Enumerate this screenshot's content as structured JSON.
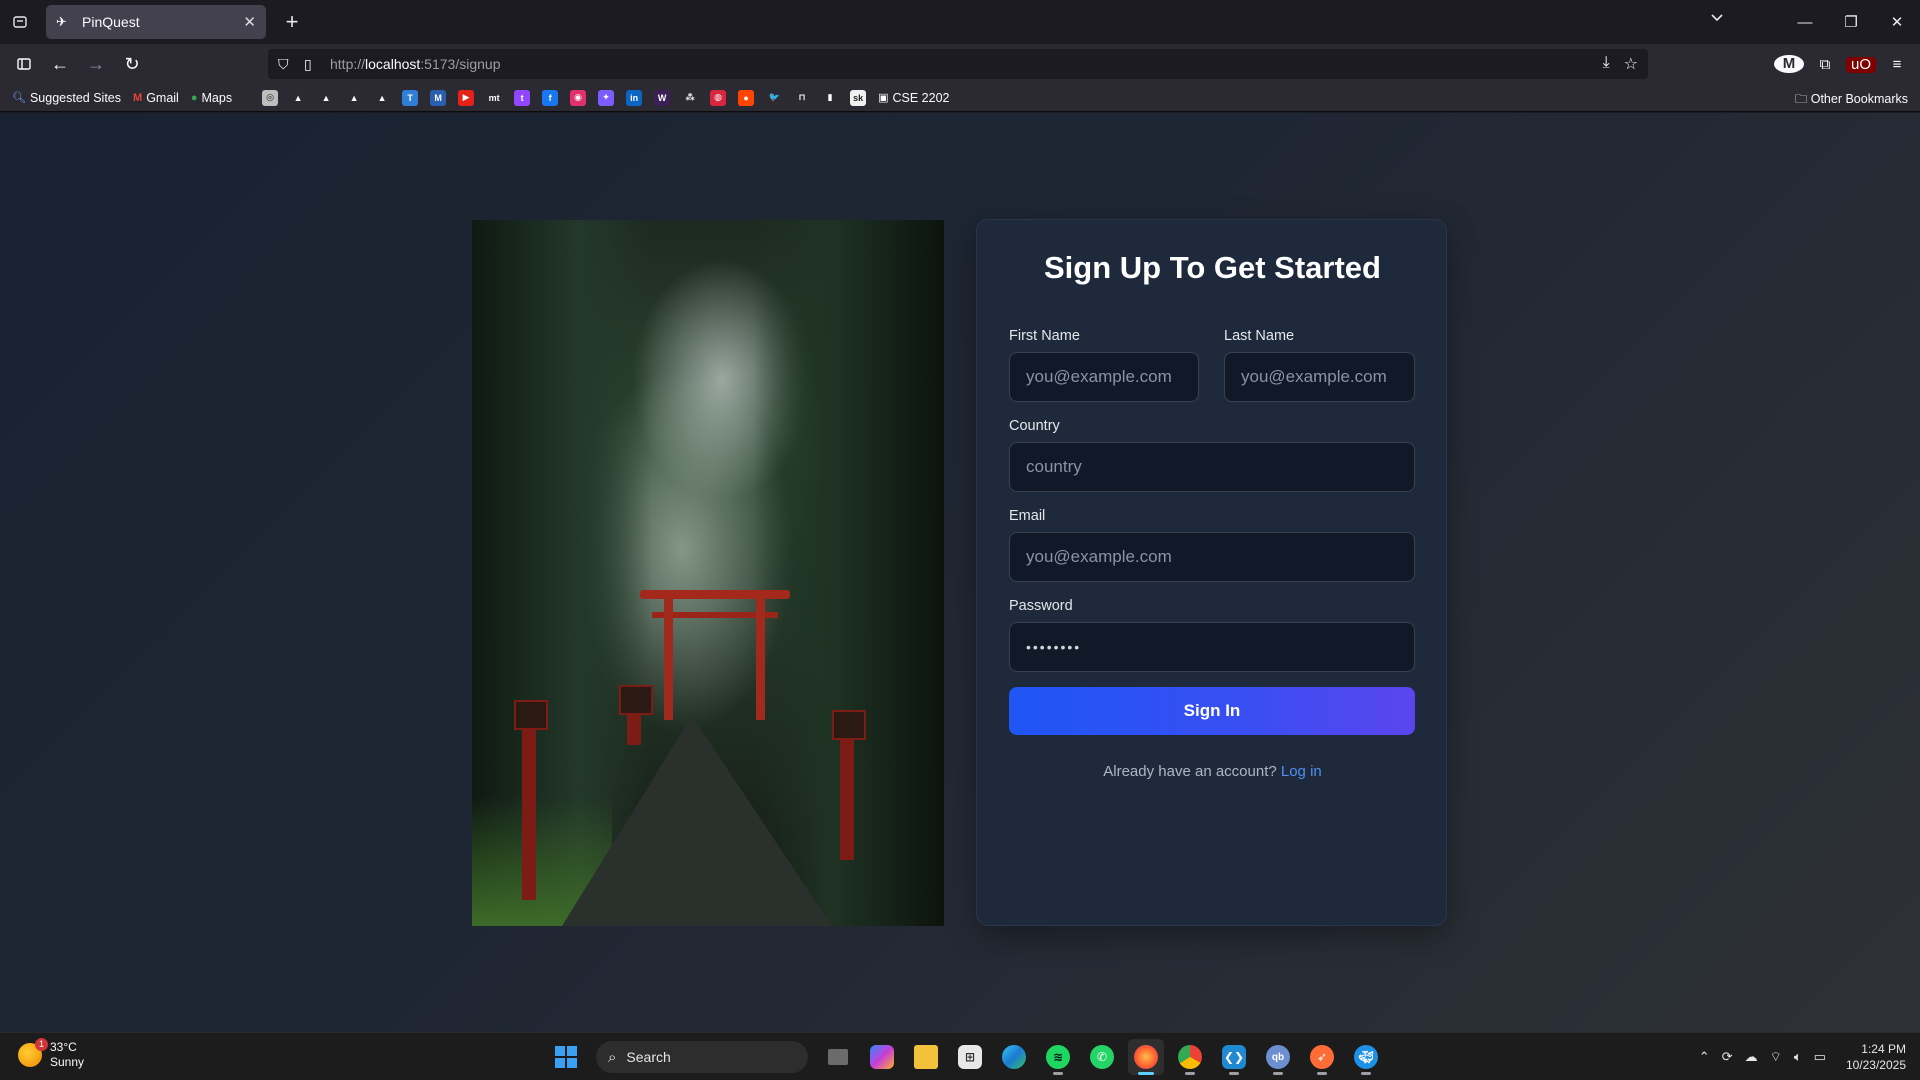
{
  "browser": {
    "tab_title": "PinQuest",
    "url_prefix": "http://",
    "url_host": "localhost",
    "url_path": ":5173/signup",
    "bookmarks": [
      {
        "label": "Suggested Sites",
        "icon": "search-icon"
      },
      {
        "label": "Gmail",
        "icon": "gmail-icon"
      },
      {
        "label": "Maps",
        "icon": "map-pin-icon"
      }
    ],
    "bookmark_icons": [
      {
        "name": "chatgpt",
        "color": "#bdbdbd",
        "glyph": "◎"
      },
      {
        "name": "drive-1",
        "color": "#2b2a33",
        "glyph": "▲"
      },
      {
        "name": "drive-2",
        "color": "#2b2a33",
        "glyph": "▲"
      },
      {
        "name": "drive-3",
        "color": "#2b2a33",
        "glyph": "▲"
      },
      {
        "name": "drive-4",
        "color": "#2b2a33",
        "glyph": "▲"
      },
      {
        "name": "bookmark-t",
        "color": "#2f7fd8",
        "glyph": "T"
      },
      {
        "name": "mail",
        "color": "#2a5fb0",
        "glyph": "M"
      },
      {
        "name": "youtube",
        "color": "#e62117",
        "glyph": "▶"
      },
      {
        "name": "mt",
        "color": "#2b2a33",
        "glyph": "mt"
      },
      {
        "name": "twitch",
        "color": "#9146ff",
        "glyph": "t"
      },
      {
        "name": "facebook",
        "color": "#1877f2",
        "glyph": "f"
      },
      {
        "name": "instagram",
        "color": "#e1306c",
        "glyph": "◉"
      },
      {
        "name": "messenger",
        "color": "#7b5cff",
        "glyph": "✦"
      },
      {
        "name": "linkedin",
        "color": "#0a66c2",
        "glyph": "in"
      },
      {
        "name": "w",
        "color": "#3b1f56",
        "glyph": "W"
      },
      {
        "name": "sites",
        "color": "#2b2a33",
        "glyph": "⁂"
      },
      {
        "name": "bookmark-red",
        "color": "#d7263d",
        "glyph": "◍"
      },
      {
        "name": "reddit",
        "color": "#ff4500",
        "glyph": "●"
      },
      {
        "name": "twitter",
        "color": "#2b2a33",
        "glyph": "🐦"
      },
      {
        "name": "bookmark-m",
        "color": "#2b2a33",
        "glyph": "⊓"
      },
      {
        "name": "chart",
        "color": "#2b2a33",
        "glyph": "▮"
      },
      {
        "name": "sk",
        "color": "#f0f0f0",
        "glyph": "sk"
      }
    ],
    "folder_bookmark": "CSE 2202",
    "other_bookmarks": "Other Bookmarks"
  },
  "page": {
    "heading": "Sign Up To Get Started",
    "first_name_label": "First Name",
    "first_name_placeholder": "you@example.com",
    "last_name_label": "Last Name",
    "last_name_placeholder": "you@example.com",
    "country_label": "Country",
    "country_placeholder": "country",
    "email_label": "Email",
    "email_placeholder": "you@example.com",
    "password_label": "Password",
    "password_value": "••••••••",
    "submit_label": "Sign In",
    "already_text": "Already have an account?",
    "login_link": "Log in"
  },
  "taskbar": {
    "temperature": "33°C",
    "condition": "Sunny",
    "weather_badge": "1",
    "search_label": "Search",
    "time": "1:24 PM",
    "date": "10/23/2025"
  }
}
